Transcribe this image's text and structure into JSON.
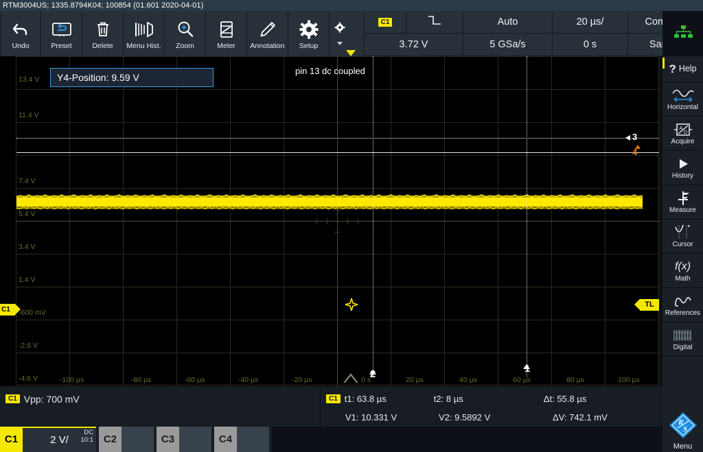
{
  "titlebar": {
    "text": "RTM3004US; 1335.8794K04; 100854 (01.601 2020-04-01)"
  },
  "toolbar": {
    "items": [
      {
        "label": "Undo",
        "icon": "undo-icon"
      },
      {
        "label": "Preset",
        "icon": "preset-icon"
      },
      {
        "label": "Delete",
        "icon": "trash-icon"
      },
      {
        "label": "Menu Hist.",
        "icon": "menu-history-icon"
      },
      {
        "label": "Zoom",
        "icon": "zoom-in-icon"
      },
      {
        "label": "Meter",
        "icon": "meter-icon"
      },
      {
        "label": "Annotation",
        "icon": "pencil-icon"
      },
      {
        "label": "Setup",
        "icon": "gear-icon"
      }
    ],
    "overflow_icon": "small-gear-icon"
  },
  "trigger_info": {
    "source": "C1",
    "slope_icon": "falling-edge-icon",
    "mode": "Auto",
    "timebase": "20 µs/",
    "acq_state": "Complete",
    "level": "3.72 V",
    "sample_rate": "5 GSa/s",
    "horiz_position": "0 s",
    "acq_mode": "Sample"
  },
  "network_icon": "network-icon",
  "plot": {
    "annotation": "pin 13 dc coupled",
    "ypos_box": "Y4-Position: 9.59 V",
    "y_labels": [
      "13.4 V",
      "11.4 V",
      "7.4 V",
      "5.4 V",
      "3.4 V",
      "1.4 V",
      "-600 mV",
      "-2.6 V",
      "-4.6 V"
    ],
    "x_labels": [
      "-100 µs",
      "-80 µs",
      "-60 µs",
      "-40 µs",
      "-20 µs",
      "0 s",
      "20 µs",
      "40 µs",
      "60 µs",
      "80 µs",
      "100 µs"
    ],
    "channel_marker": "C1",
    "trigger_level_marker": "TL",
    "cursor_vertical_labels": [
      "2",
      "1"
    ],
    "cursor_horizontal_labels": [
      "3",
      "4"
    ],
    "waveform_color": "#ffe900"
  },
  "sidebar": {
    "help": {
      "label": "Help",
      "icon": "question-mark-icon"
    },
    "items": [
      {
        "label": "Horizontal",
        "icon": "horizontal-icon"
      },
      {
        "label": "Acquire",
        "icon": "acquire-icon"
      },
      {
        "label": "History",
        "icon": "play-icon"
      },
      {
        "label": "Measure",
        "icon": "measure-icon"
      },
      {
        "label": "Cursor",
        "icon": "cursor-icon"
      },
      {
        "label": "Math",
        "icon": "math-icon"
      },
      {
        "label": "References",
        "icon": "references-icon"
      },
      {
        "label": "Digital",
        "icon": "digital-icon"
      }
    ],
    "menu": {
      "label": "Menu",
      "icon": "rs-logo-icon"
    }
  },
  "results": {
    "measurement": {
      "channel": "C1",
      "text": "Vpp: 700 mV"
    },
    "cursor": {
      "channel": "C1",
      "row1": [
        "t1: 63.8 µs",
        "t2: 8 µs",
        "Δt: 55.8 µs"
      ],
      "row2": [
        "V1: 10.331 V",
        "V2: 9.5892 V",
        "ΔV: 742.1 mV"
      ]
    }
  },
  "channels": [
    {
      "name": "C1",
      "scale": "2 V/",
      "coupling": "DC",
      "probe": "10:1",
      "active": true
    },
    {
      "name": "C2",
      "active": false
    },
    {
      "name": "C3",
      "active": false
    },
    {
      "name": "C4",
      "active": false
    }
  ]
}
